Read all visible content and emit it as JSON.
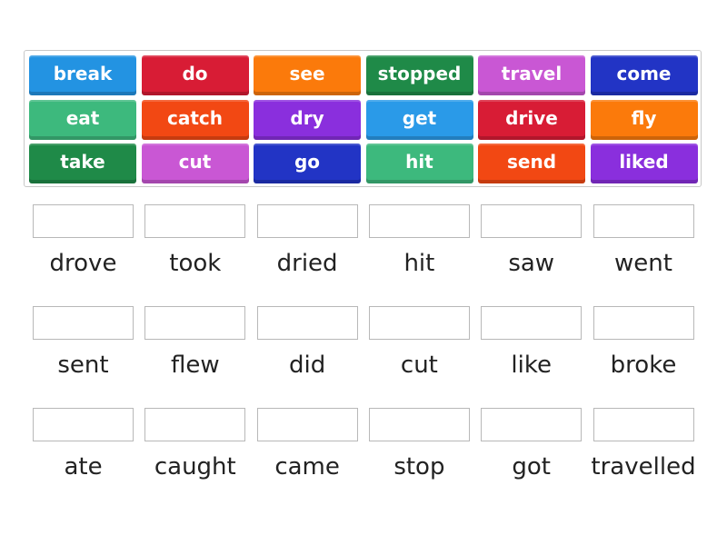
{
  "tiles": [
    {
      "label": "break",
      "color": "#2393e2"
    },
    {
      "label": "do",
      "color": "#d81c35"
    },
    {
      "label": "see",
      "color": "#fb7a0b"
    },
    {
      "label": "stopped",
      "color": "#1f8a48"
    },
    {
      "label": "travel",
      "color": "#c957d4"
    },
    {
      "label": "come",
      "color": "#2234c5"
    },
    {
      "label": "eat",
      "color": "#3db97d"
    },
    {
      "label": "catch",
      "color": "#f24813"
    },
    {
      "label": "dry",
      "color": "#8a2fdd"
    },
    {
      "label": "get",
      "color": "#2a9ae8"
    },
    {
      "label": "drive",
      "color": "#d81c35"
    },
    {
      "label": "fly",
      "color": "#fb7a0b"
    },
    {
      "label": "take",
      "color": "#1f8a48"
    },
    {
      "label": "cut",
      "color": "#c957d4"
    },
    {
      "label": "go",
      "color": "#2234c5"
    },
    {
      "label": "hit",
      "color": "#3db97d"
    },
    {
      "label": "send",
      "color": "#f24813"
    },
    {
      "label": "liked",
      "color": "#8a2fdd"
    }
  ],
  "targets": [
    {
      "label": "drove",
      "value": ""
    },
    {
      "label": "took",
      "value": ""
    },
    {
      "label": "dried",
      "value": ""
    },
    {
      "label": "hit",
      "value": ""
    },
    {
      "label": "saw",
      "value": ""
    },
    {
      "label": "went",
      "value": ""
    },
    {
      "label": "sent",
      "value": ""
    },
    {
      "label": "flew",
      "value": ""
    },
    {
      "label": "did",
      "value": ""
    },
    {
      "label": "cut",
      "value": ""
    },
    {
      "label": "like",
      "value": ""
    },
    {
      "label": "broke",
      "value": ""
    },
    {
      "label": "ate",
      "value": ""
    },
    {
      "label": "caught",
      "value": ""
    },
    {
      "label": "came",
      "value": ""
    },
    {
      "label": "stop",
      "value": ""
    },
    {
      "label": "got",
      "value": ""
    },
    {
      "label": "travelled",
      "value": ""
    }
  ]
}
